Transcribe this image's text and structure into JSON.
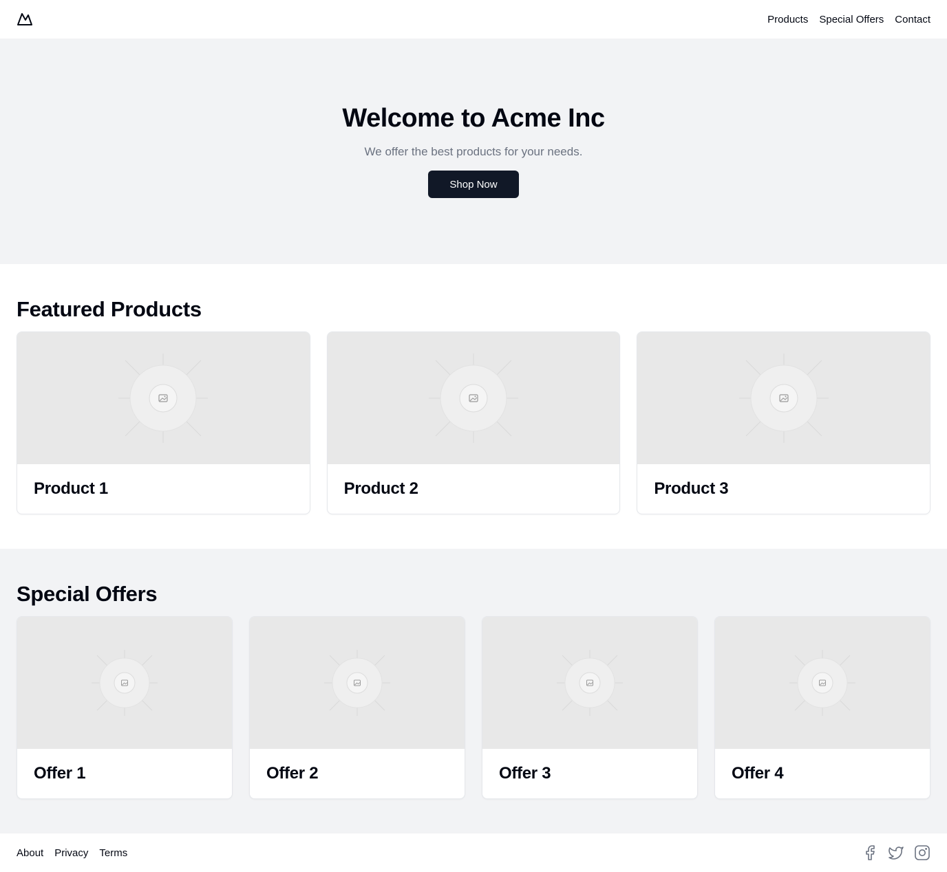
{
  "header": {
    "logo_icon": "mountain-icon",
    "nav": [
      {
        "label": "Products"
      },
      {
        "label": "Special Offers"
      },
      {
        "label": "Contact"
      }
    ]
  },
  "hero": {
    "title": "Welcome to Acme Inc",
    "subtitle": "We offer the best products for your needs.",
    "cta_label": "Shop Now"
  },
  "featured": {
    "title": "Featured Products",
    "items": [
      {
        "title": "Product 1",
        "image_icon": "image-placeholder-icon"
      },
      {
        "title": "Product 2",
        "image_icon": "image-placeholder-icon"
      },
      {
        "title": "Product 3",
        "image_icon": "image-placeholder-icon"
      }
    ]
  },
  "offers": {
    "title": "Special Offers",
    "items": [
      {
        "title": "Offer 1",
        "image_icon": "image-placeholder-icon"
      },
      {
        "title": "Offer 2",
        "image_icon": "image-placeholder-icon"
      },
      {
        "title": "Offer 3",
        "image_icon": "image-placeholder-icon"
      },
      {
        "title": "Offer 4",
        "image_icon": "image-placeholder-icon"
      }
    ]
  },
  "footer": {
    "links": [
      {
        "label": "About"
      },
      {
        "label": "Privacy"
      },
      {
        "label": "Terms"
      }
    ],
    "socials": [
      "facebook-icon",
      "twitter-icon",
      "instagram-icon"
    ]
  },
  "colors": {
    "primary_button": "#111827",
    "section_bg": "#f2f3f5",
    "muted_text": "#6b7280",
    "placeholder_bg": "#e8e8e8"
  }
}
